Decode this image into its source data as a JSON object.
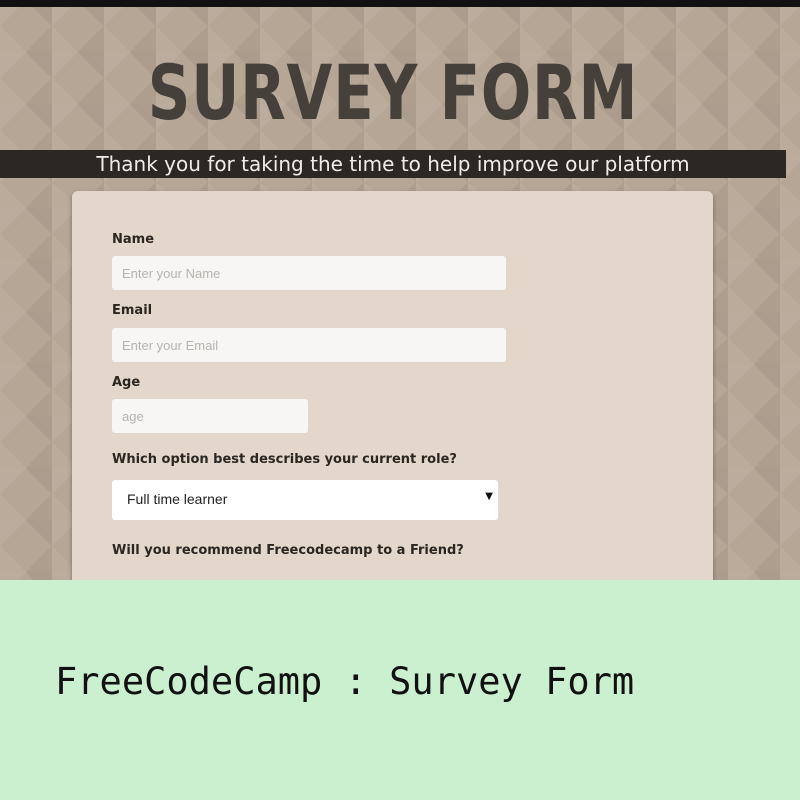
{
  "header": {
    "title": "SURVEY FORM",
    "subtitle": "Thank you for taking the time to help improve our platform"
  },
  "form": {
    "name": {
      "label": "Name",
      "placeholder": "Enter your Name",
      "value": ""
    },
    "email": {
      "label": "Email",
      "placeholder": "Enter your Email",
      "value": ""
    },
    "age": {
      "label": "Age",
      "placeholder": "age",
      "value": ""
    },
    "role": {
      "label": "Which option best describes your current role?",
      "selected": "Full time learner"
    },
    "recommend": {
      "label": "Will you recommend Freecodecamp to a Friend?"
    }
  },
  "caption": "FreeCodeCamp : Survey Form",
  "colors": {
    "background": "#b6a696",
    "card": "#e3d6ca",
    "banner": "#2b2723",
    "caption_bg": "#cbf0cf"
  }
}
